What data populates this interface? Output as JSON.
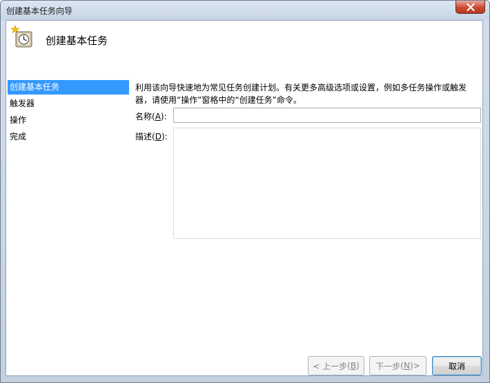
{
  "window": {
    "title": "创建基本任务向导"
  },
  "header": {
    "title": "创建基本任务",
    "icon": "clock-icon"
  },
  "sidebar": {
    "items": [
      {
        "label": "创建基本任务",
        "active": true
      },
      {
        "label": "触发器",
        "active": false
      },
      {
        "label": "操作",
        "active": false
      },
      {
        "label": "完成",
        "active": false
      }
    ]
  },
  "main": {
    "intro_line1": "利用该向导快速地为常见任务创建计划。有关更多高级选项或设置，例如多任务操作或触发",
    "intro_line2": "器，请使用“操作”窗格中的“创建任务”命令。",
    "name_label": "名称",
    "name_access_key": "A",
    "name_value": "",
    "desc_label": "描述",
    "desc_access_key": "D",
    "desc_value": ""
  },
  "buttons": {
    "back": {
      "label": "< 上一步",
      "access_key": "B",
      "enabled": false
    },
    "next": {
      "label": "下一步",
      "access_key": "N",
      "suffix": " >",
      "enabled": false
    },
    "cancel": {
      "label": "取消",
      "enabled": true
    }
  },
  "colors": {
    "selection": "#3399ff",
    "close_button": "#c84a31",
    "frame": "#c6d4e4"
  }
}
